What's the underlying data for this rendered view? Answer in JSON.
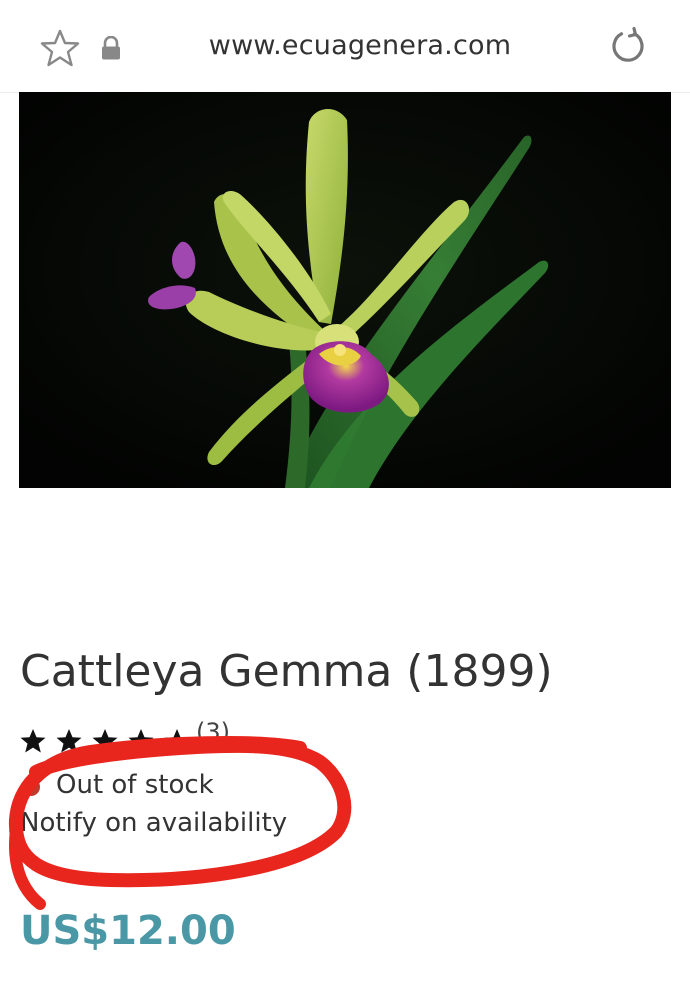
{
  "browser": {
    "url": "www.ecuagenera.com",
    "icons": {
      "bookmark": "star-outline-icon",
      "security": "lock-icon",
      "reload": "reload-icon"
    }
  },
  "product": {
    "image_description": "orchid-photo",
    "title": "Cattleya Gemma (1899)",
    "rating": {
      "stars": 5,
      "filled": 5,
      "count_label": "(3)"
    },
    "stock_status": "Out of stock",
    "notify_link": "Notify on availability",
    "price": "US$12.00"
  },
  "colors": {
    "price": "#4a98a6",
    "stock_dot": "#c0392b",
    "annotation": "#e8261d"
  }
}
